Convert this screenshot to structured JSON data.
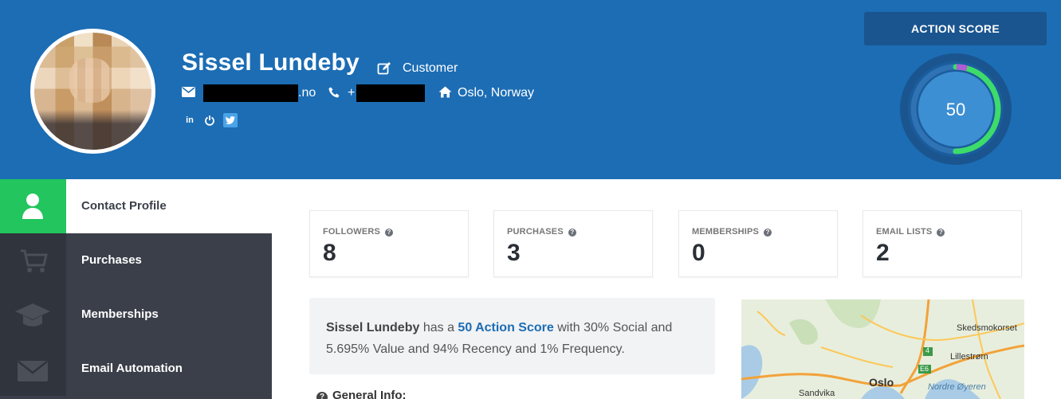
{
  "header": {
    "name": "Sissel Lundeby",
    "role": "Customer",
    "email_suffix": ".no",
    "phone_prefix": "+",
    "location": "Oslo, Norway",
    "socials": [
      "in",
      "power",
      "twitter"
    ],
    "brand_color": "#1c6db4"
  },
  "action_score": {
    "label": "ACTION SCORE",
    "value": "50",
    "fraction": 0.5
  },
  "sidebar": {
    "items": [
      {
        "label": "Contact Profile",
        "icon": "user-icon",
        "active": true
      },
      {
        "label": "Purchases",
        "icon": "cart-icon",
        "active": false
      },
      {
        "label": "Memberships",
        "icon": "graduation-cap-icon",
        "active": false
      },
      {
        "label": "Email Automation",
        "icon": "envelope-icon",
        "active": false
      }
    ]
  },
  "stats": [
    {
      "label": "FOLLOWERS",
      "value": "8"
    },
    {
      "label": "PURCHASES",
      "value": "3"
    },
    {
      "label": "MEMBERSHIPS",
      "value": "0"
    },
    {
      "label": "EMAIL LISTS",
      "value": "2"
    }
  ],
  "summary": {
    "name": "Sissel Lundeby",
    "has_a": "has a",
    "score_text": "50 Action Score",
    "rest": "with 30% Social and 5.695% Value and 94% Recency and 1% Frequency."
  },
  "general_info": "General Info:",
  "map": {
    "labels": [
      "Skedsmokorset",
      "Lillestrøm",
      "Oslo",
      "Nordre Øyeren",
      "Sandvika"
    ],
    "road_numbers": [
      "4",
      "E6"
    ]
  }
}
